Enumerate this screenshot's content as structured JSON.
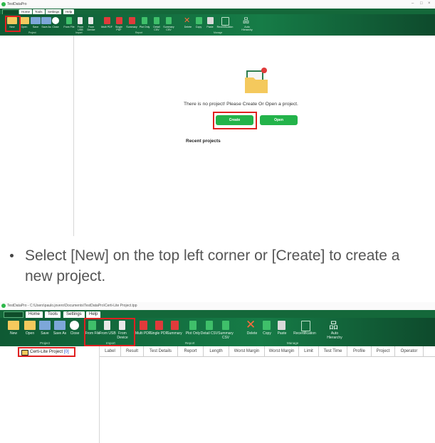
{
  "screen1": {
    "title": "TestDataPro",
    "tabs": [
      "Home",
      "Tools",
      "Settings",
      "Help"
    ],
    "ribbon": [
      "New",
      "Open",
      "Save",
      "Save As",
      "Close",
      "From File",
      "From USB",
      "From Device",
      "Multi PDF",
      "Single PDF",
      "Summary",
      "Plot Only",
      "Detail CSV",
      "Summary CSV",
      "Delete",
      "Copy",
      "Paste",
      "Recertification",
      "Auto Hierarchy"
    ],
    "groups": [
      "Project",
      "Import",
      "Report",
      "Manage"
    ],
    "empty_message": "There is no project! Please Create Or Open a project.",
    "create_label": "Create",
    "open_label": "Open",
    "recent_label": "Recent projects"
  },
  "instruction": "Select [New] on the top left corner or [Create] to create a new project.",
  "screen2": {
    "title": "TestDataPro - C:\\Users\\paulo.jovero\\Documents\\TestDataPro\\Certi-Lite Project.tpp",
    "tabs": [
      "Home",
      "Tools",
      "Settings",
      "Help"
    ],
    "ribbon": [
      "New",
      "Open",
      "Save",
      "Save As",
      "Close",
      "From File",
      "From USB",
      "From Device",
      "Multi PDF",
      "Single PDF",
      "Summary",
      "Plot Only",
      "Detail CSV",
      "Summary CSV",
      "Delete",
      "Copy",
      "Paste",
      "Recertification",
      "Auto Hierarchy"
    ],
    "groups": [
      "Project",
      "Import",
      "Report",
      "Manage"
    ],
    "project_name": "Certi-Lite Project",
    "project_count": "[0]",
    "columns": [
      "Label",
      "Result",
      "Test Details",
      "Report",
      "Length",
      "Worst Margin",
      "Worst Margin",
      "Limit",
      "Test Time",
      "Profile",
      "Project",
      "Operator"
    ]
  },
  "colors": {
    "ribbon": "#167c47",
    "accent": "#23b34a",
    "highlight": "#e02020"
  }
}
